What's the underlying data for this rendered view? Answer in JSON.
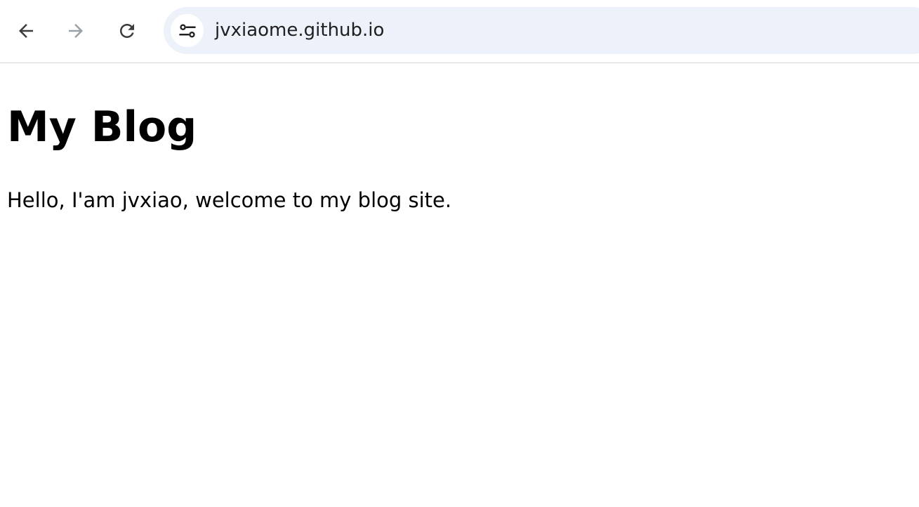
{
  "browser": {
    "url": "jvxiaome.github.io",
    "icons": {
      "back": "arrow-left-icon",
      "forward": "arrow-right-icon",
      "reload": "reload-icon",
      "site_info": "tune-icon"
    },
    "colors": {
      "omnibox_bg": "#ecf1fa",
      "forward_disabled": "#9aa0a6",
      "icon": "#3c3c3c"
    }
  },
  "page": {
    "title": "My Blog",
    "intro": "Hello, I'am jvxiao, welcome to my blog site."
  }
}
